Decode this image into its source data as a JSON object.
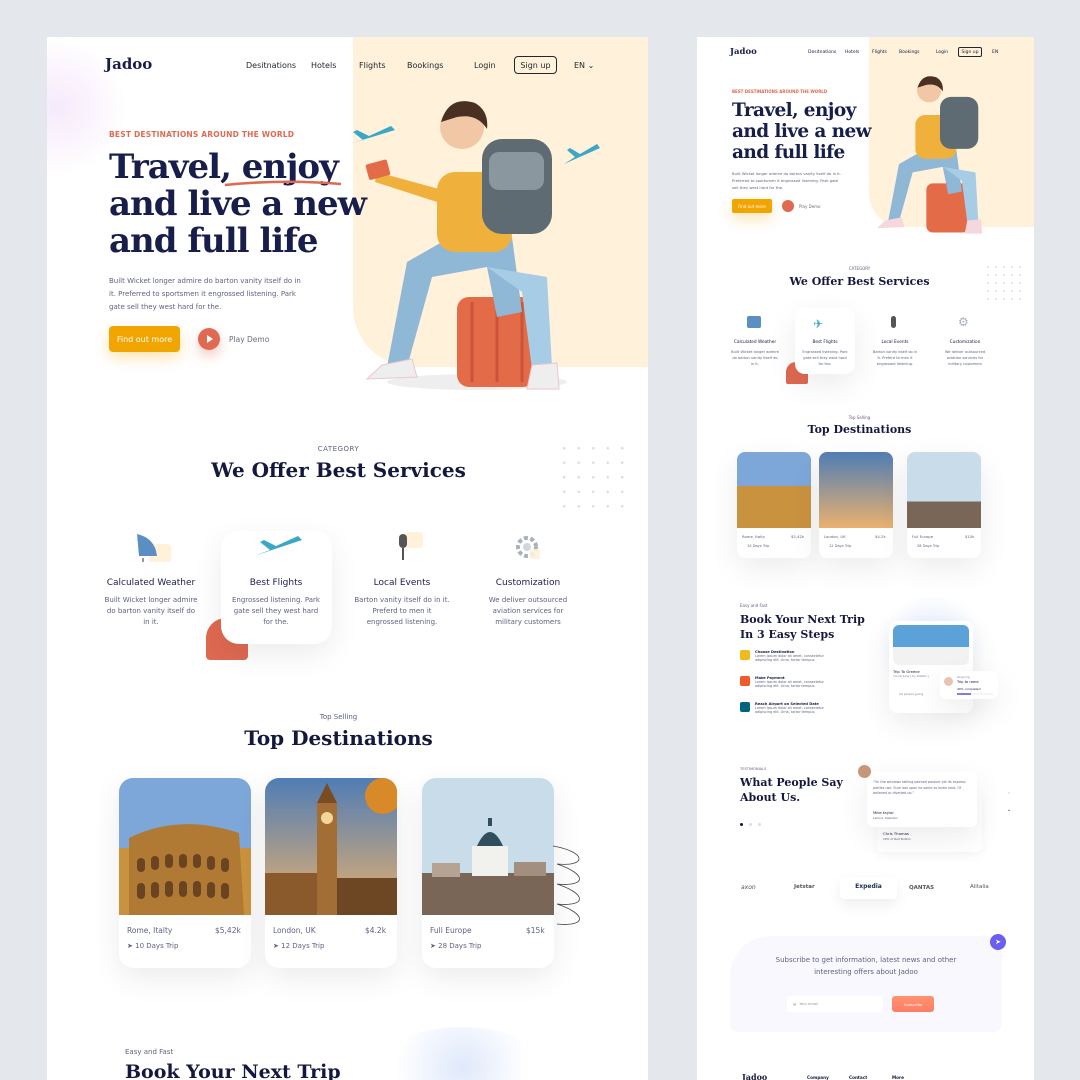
{
  "brand": "Jadoo",
  "nav": {
    "destinations": "Desitnations",
    "hotels": "Hotels",
    "flights": "Flights",
    "bookings": "Bookings",
    "login": "Login",
    "signup": "Sign up",
    "lang": "EN"
  },
  "hero": {
    "eyebrow": "BEST DESTINATIONS AROUND THE WORLD",
    "line1": "Travel, enjoy",
    "line2": "and live a new",
    "line3": "and full life",
    "desc": "Built Wicket longer admire do barton vanity itself do in it. Preferred to sportsmen it engrossed listening. Park gate sell they west hard for the.",
    "cta": "Find out more",
    "demo": "Play Demo"
  },
  "services": {
    "eyebrow": "CATEGORY",
    "title": "We Offer Best Services",
    "items": [
      {
        "title": "Calculated Weather",
        "desc": "Built Wicket longer admire do barton vanity itself do in it.",
        "icon": "satellite-dish-icon"
      },
      {
        "title": "Best Flights",
        "desc": "Engrossed listening. Park gate sell they west hard for the.",
        "icon": "airplane-icon"
      },
      {
        "title": "Local Events",
        "desc": "Barton vanity itself do in it. Preferd to men it engrossed listening.",
        "icon": "microphone-icon"
      },
      {
        "title": "Customization",
        "desc": "We deliver outsourced aviation services for military customers",
        "icon": "gear-icon"
      }
    ]
  },
  "destinations": {
    "eyebrow": "Top Selling",
    "title": "Top Destinations",
    "items": [
      {
        "place": "Rome, Italty",
        "price": "$5,42k",
        "trip": "10 Days Trip"
      },
      {
        "place": "London, UK",
        "price": "$4.2k",
        "trip": "12 Days Trip"
      },
      {
        "place": "Full Europe",
        "price": "$15k",
        "trip": "28 Days Trip"
      }
    ]
  },
  "steps": {
    "eyebrow": "Easy and Fast",
    "title_big": "Book Your Next Trip",
    "title1": "Book Your Next Trip",
    "title2": "In 3 Easy Steps",
    "items": [
      {
        "title": "Choose Destination",
        "desc": "Lorem ipsum dolor sit amet, consectetur adipiscing elit. Urna, tortor tempus."
      },
      {
        "title": "Make Payment",
        "desc": "Lorem ipsum dolor sit amet, consectetur adipiscing elit. Urna, tortor tempus."
      },
      {
        "title": "Reach Airport on Selected Date",
        "desc": "Lorem ipsum dolor sit amet, consectetur adipiscing elit. Urna, tortor tempus."
      }
    ],
    "trip_card": {
      "title": "Trip To Greece",
      "meta": "14-29 June  |  by Robbin j",
      "people": "24 people going",
      "ongoing": "Ongoing",
      "ongoing_trip": "Trip to rome",
      "progress_label": "40% completed",
      "progress": 0.4
    }
  },
  "testimonials": {
    "eyebrow": "TESTIMONIALS",
    "title1": "What People Say",
    "title2": "About Us.",
    "quote": "“On the windows talking painted pasture yet its express parties use. Sure last upon he same as knew next. Of believed or diverted no.”",
    "name": "Mike taylor",
    "city": "Lahore, Pakistan",
    "name2": "Chris Thomas",
    "role2": "CEO of Red Button"
  },
  "partners": [
    "axon",
    "Jetstar",
    "Expedia",
    "QANTAS",
    "Alitalia"
  ],
  "subscribe": {
    "text": "Subscribe to get information, latest news and other interesting offers about Jadoo",
    "placeholder": "Your email",
    "button": "Subscribe"
  },
  "footer": {
    "brand": "Jadoo",
    "col1": "Company",
    "col2": "Contact",
    "col3": "More"
  },
  "colors": {
    "accent": "#f1a501",
    "coral": "#df6951",
    "navy": "#14183e",
    "cream": "#fff1da"
  }
}
